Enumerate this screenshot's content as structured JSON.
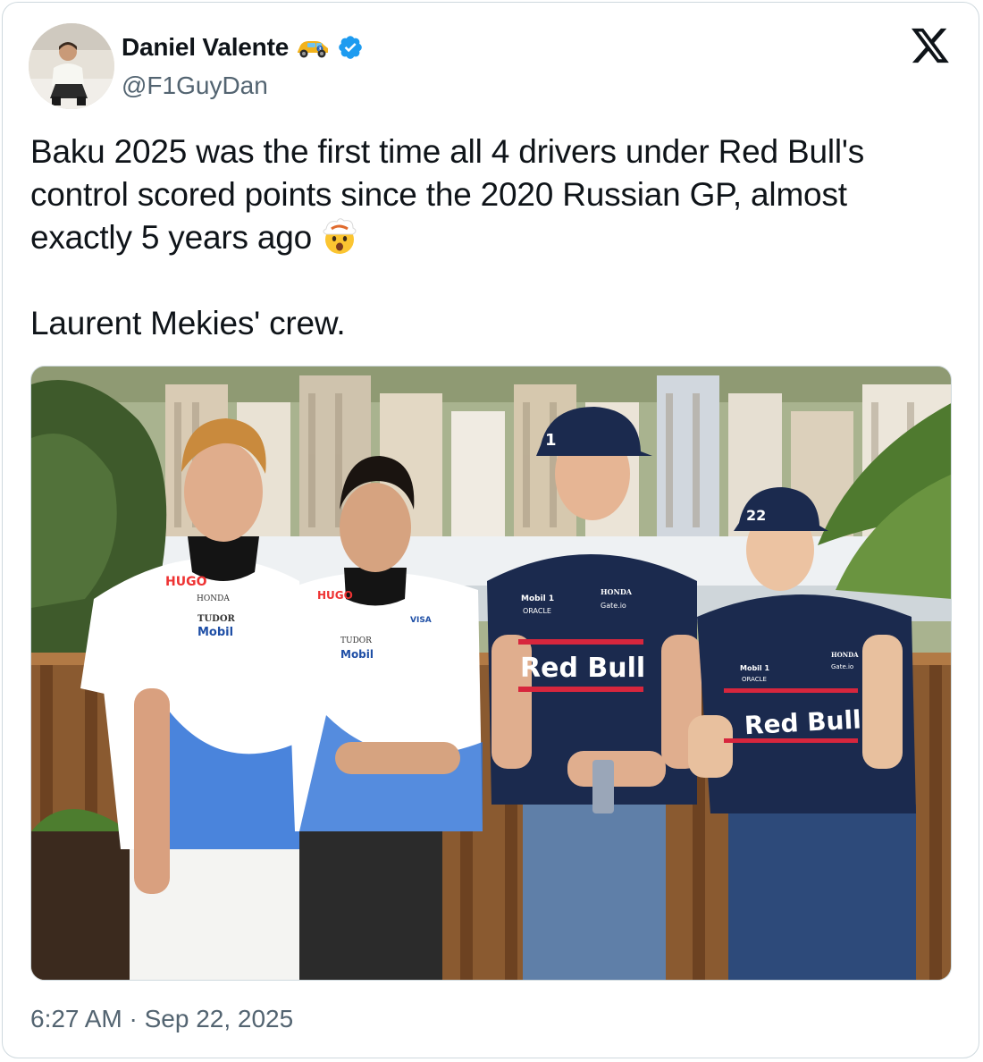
{
  "author": {
    "display_name": "Daniel Valente",
    "handle": "@F1GuyDan",
    "verified": true,
    "name_emoji": "racing-car-emoji",
    "avatar": "avatar-photo"
  },
  "platform": {
    "logo": "x-logo-icon"
  },
  "tweet": {
    "lines": [
      "Baku 2025 was the first time all 4 drivers under Red Bull's control scored points since the 2020 Russian GP, almost exactly 5 years ago",
      "Laurent Mekies' crew."
    ],
    "trailing_emoji": "exploding-head-emoji"
  },
  "photo": {
    "jersey_text": {
      "racing_bulls": [
        "HUGO",
        "HONDA",
        "TUDOR",
        "Mobil",
        "VISA"
      ],
      "red_bull": [
        "Red Bull",
        "Mobil 1",
        "ORACLE",
        "HONDA",
        "Gate.io"
      ],
      "cap_numbers": [
        "1",
        "22"
      ]
    }
  },
  "meta": {
    "timestamp": "6:27 AM · Sep 22, 2025"
  },
  "colors": {
    "verified_blue": "#1d9bf0",
    "text_primary": "#0f1419",
    "text_secondary": "#536471",
    "border": "#cfd9de",
    "red_bull_navy": "#1b2a4e",
    "racing_bulls_blue": "#2a6fd6"
  }
}
